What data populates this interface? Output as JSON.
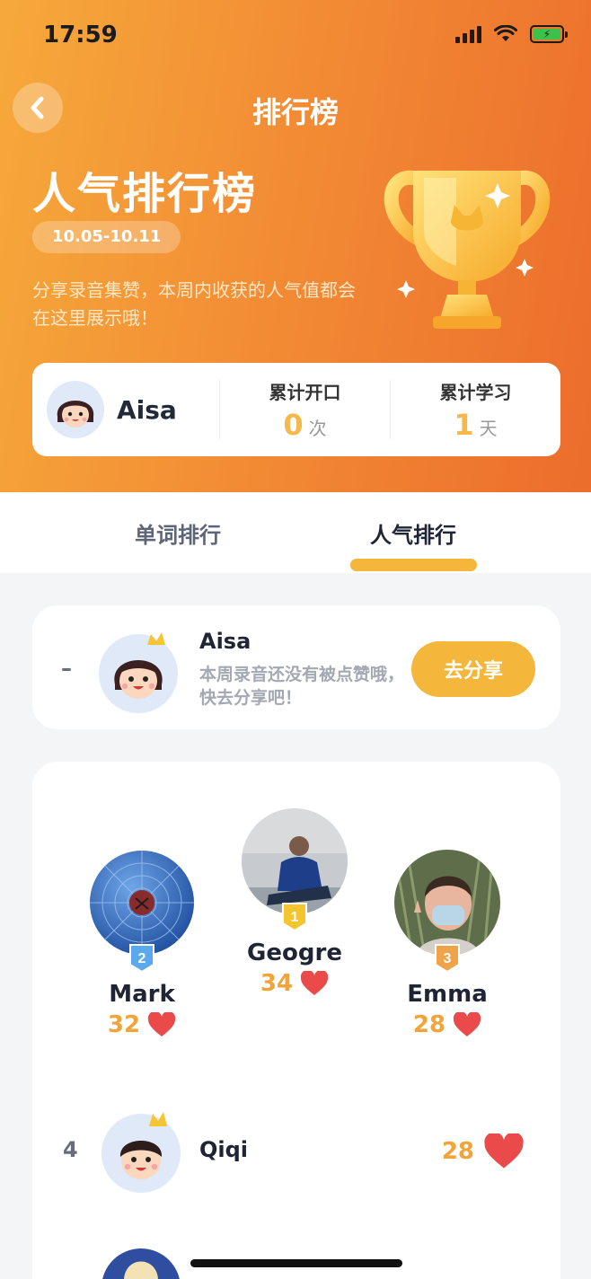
{
  "status_bar": {
    "time": "17:59",
    "battery_icon": "charging-battery-icon"
  },
  "nav": {
    "title": "排行榜",
    "back_icon": "chevron-left-icon"
  },
  "hero": {
    "title": "人气排行榜",
    "date_range": "10.05-10.11",
    "description": "分享录音集赞，本周内收获的人气值都会在这里展示哦！"
  },
  "stats": {
    "user_name": "Aisa",
    "speaking_label": "累计开口",
    "speaking_value": "0",
    "speaking_unit": "次",
    "study_label": "累计学习",
    "study_value": "1",
    "study_unit": "天"
  },
  "tabs": [
    {
      "label": "单词排行",
      "active": false
    },
    {
      "label": "人气排行",
      "active": true
    }
  ],
  "my_rank": {
    "rank": "–",
    "name": "Aisa",
    "message": "本周录音还没有被点赞哦，快去分享吧！",
    "share_label": "去分享"
  },
  "podium": [
    {
      "rank": "1",
      "name": "Geogre",
      "score": "34"
    },
    {
      "rank": "2",
      "name": "Mark",
      "score": "32"
    },
    {
      "rank": "3",
      "name": "Emma",
      "score": "28"
    }
  ],
  "list": [
    {
      "rank": "4",
      "name": "Qiqi",
      "score": "28"
    }
  ],
  "colors": {
    "accent": "#f4b63b",
    "header_start": "#f6a93b",
    "header_end": "#ec6d2c",
    "heart": "#ea4a4a",
    "score": "#f1a43a"
  }
}
